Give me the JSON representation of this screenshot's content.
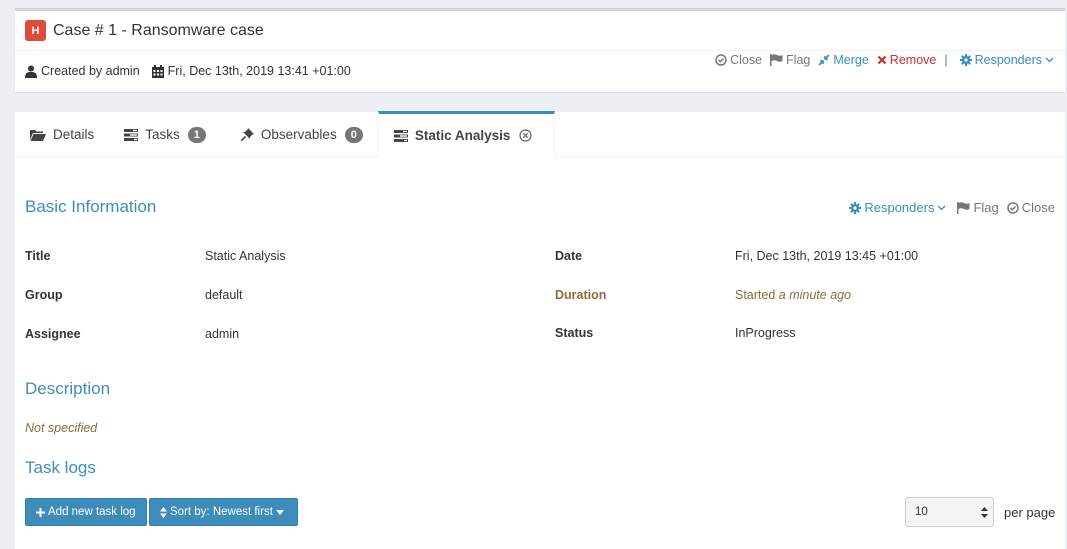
{
  "case": {
    "severity": "H",
    "title": "Case # 1 - Ransomware case",
    "created_by": "Created by admin",
    "date": "Fri, Dec 13th, 2019 13:41 +01:00",
    "actions": {
      "close": "Close",
      "flag": "Flag",
      "merge": "Merge",
      "remove": "Remove",
      "responders": "Responders"
    }
  },
  "tabs": [
    {
      "label": "Details",
      "icon": "folder-open-icon"
    },
    {
      "label": "Tasks",
      "icon": "tasks-icon",
      "badge": "1"
    },
    {
      "label": "Observables",
      "icon": "pushpin-icon",
      "badge": "0"
    },
    {
      "label": "Static Analysis",
      "icon": "tasks-icon",
      "active": true
    }
  ],
  "task": {
    "basic_info_title": "Basic Information",
    "actions": {
      "responders": "Responders",
      "flag": "Flag",
      "close": "Close"
    },
    "fields": {
      "title_label": "Title",
      "title_value": "Static Analysis",
      "group_label": "Group",
      "group_value": "default",
      "assignee_label": "Assignee",
      "assignee_value": "admin",
      "date_label": "Date",
      "date_value": "Fri, Dec 13th, 2019 13:45 +01:00",
      "duration_label": "Duration",
      "duration_prefix": "Started",
      "duration_value": "a minute ago",
      "status_label": "Status",
      "status_value": "InProgress"
    },
    "description_title": "Description",
    "description_value": "Not specified",
    "task_logs_title": "Task logs",
    "add_log_button": "Add new task log",
    "sort_button": "Sort by: Newest first",
    "per_page_value": "10",
    "per_page_label": "per page"
  },
  "colors": {
    "accent": "#3c8dbc",
    "danger": "#dd4b39",
    "muted": "#8a6d3b"
  }
}
